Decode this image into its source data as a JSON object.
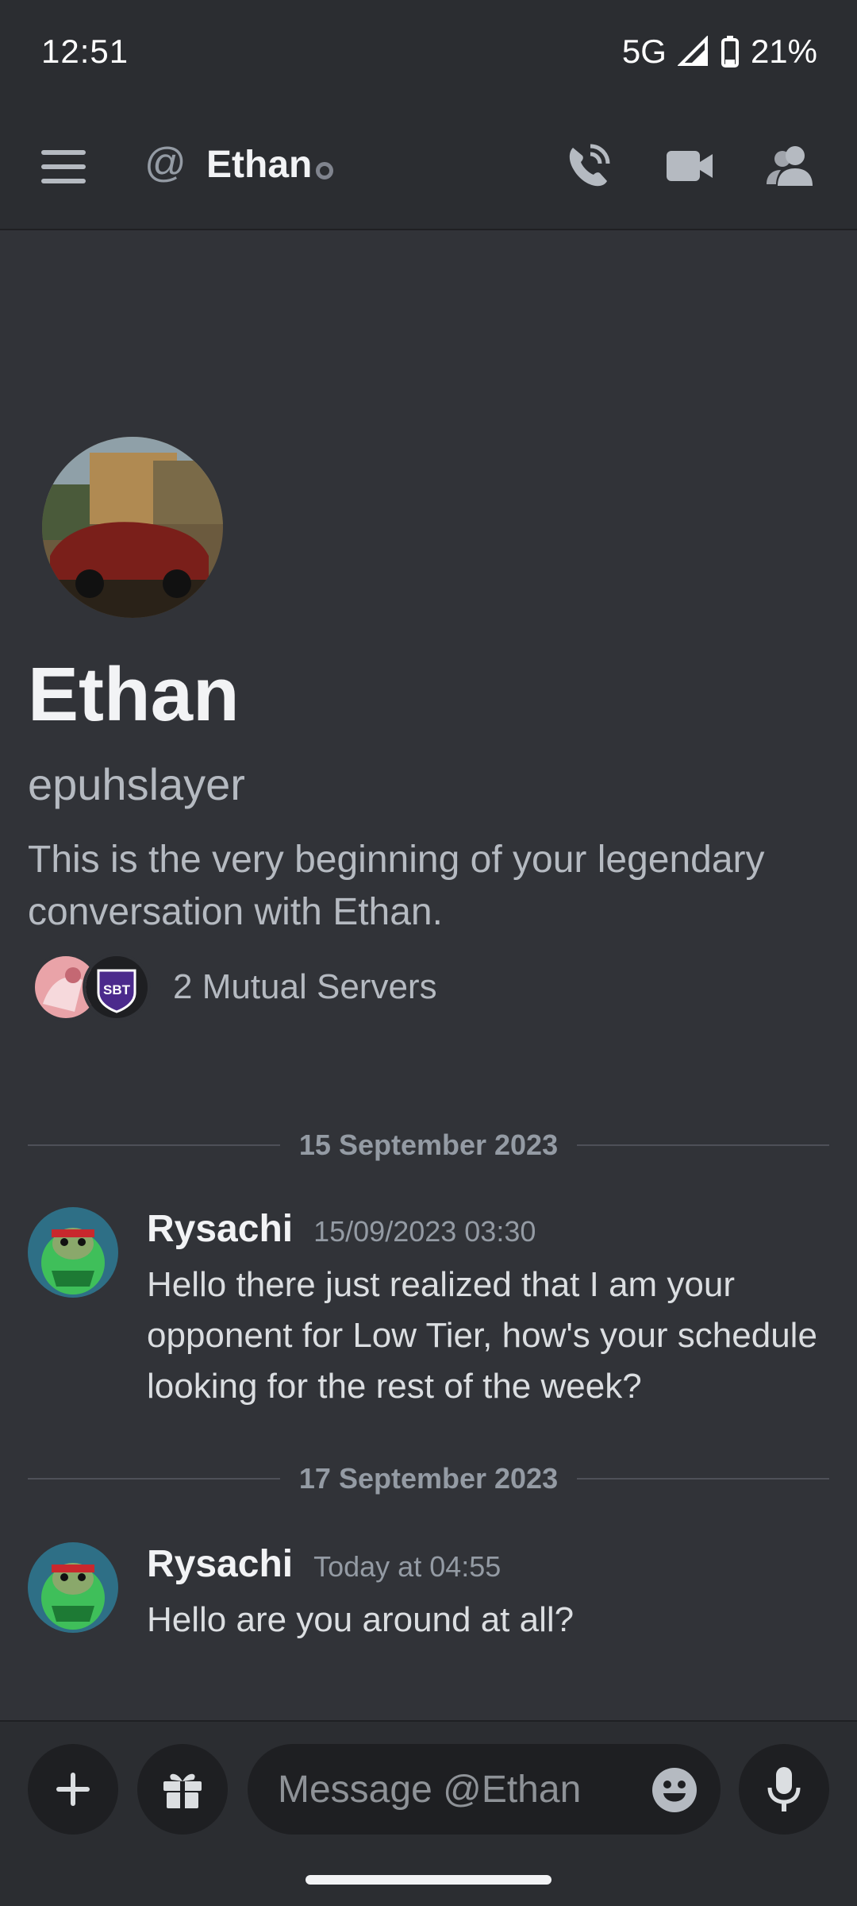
{
  "status_bar": {
    "time": "12:51",
    "network": "5G",
    "battery": "21%"
  },
  "header": {
    "at_symbol": "@",
    "name": "Ethan",
    "icons": [
      "menu-icon",
      "phone-call-icon",
      "video-call-icon",
      "members-icon"
    ]
  },
  "profile": {
    "display_name": "Ethan",
    "username": "epuhslayer",
    "intro": "This is the very beginning of your legendary conversation with Ethan.",
    "mutual_servers_label": "2 Mutual Servers",
    "server_badge_text": "SBT"
  },
  "messages": [
    {
      "date_divider": "15 September 2023",
      "author": "Rysachi",
      "timestamp": "15/09/2023 03:30",
      "text": "Hello there just realized that I am your opponent for Low Tier, how's your schedule looking for the rest of the week?"
    },
    {
      "date_divider": "17 September 2023",
      "author": "Rysachi",
      "timestamp": "Today at 04:55",
      "text": "Hello are you around at all?"
    }
  ],
  "composer": {
    "placeholder": "Message @Ethan",
    "icons": [
      "plus-icon",
      "gift-icon",
      "emoji-icon",
      "microphone-icon"
    ]
  },
  "colors": {
    "background": "#313338",
    "header_background": "#2b2d31",
    "input_background": "#1e1f22",
    "muted_text": "#b5bac1"
  }
}
